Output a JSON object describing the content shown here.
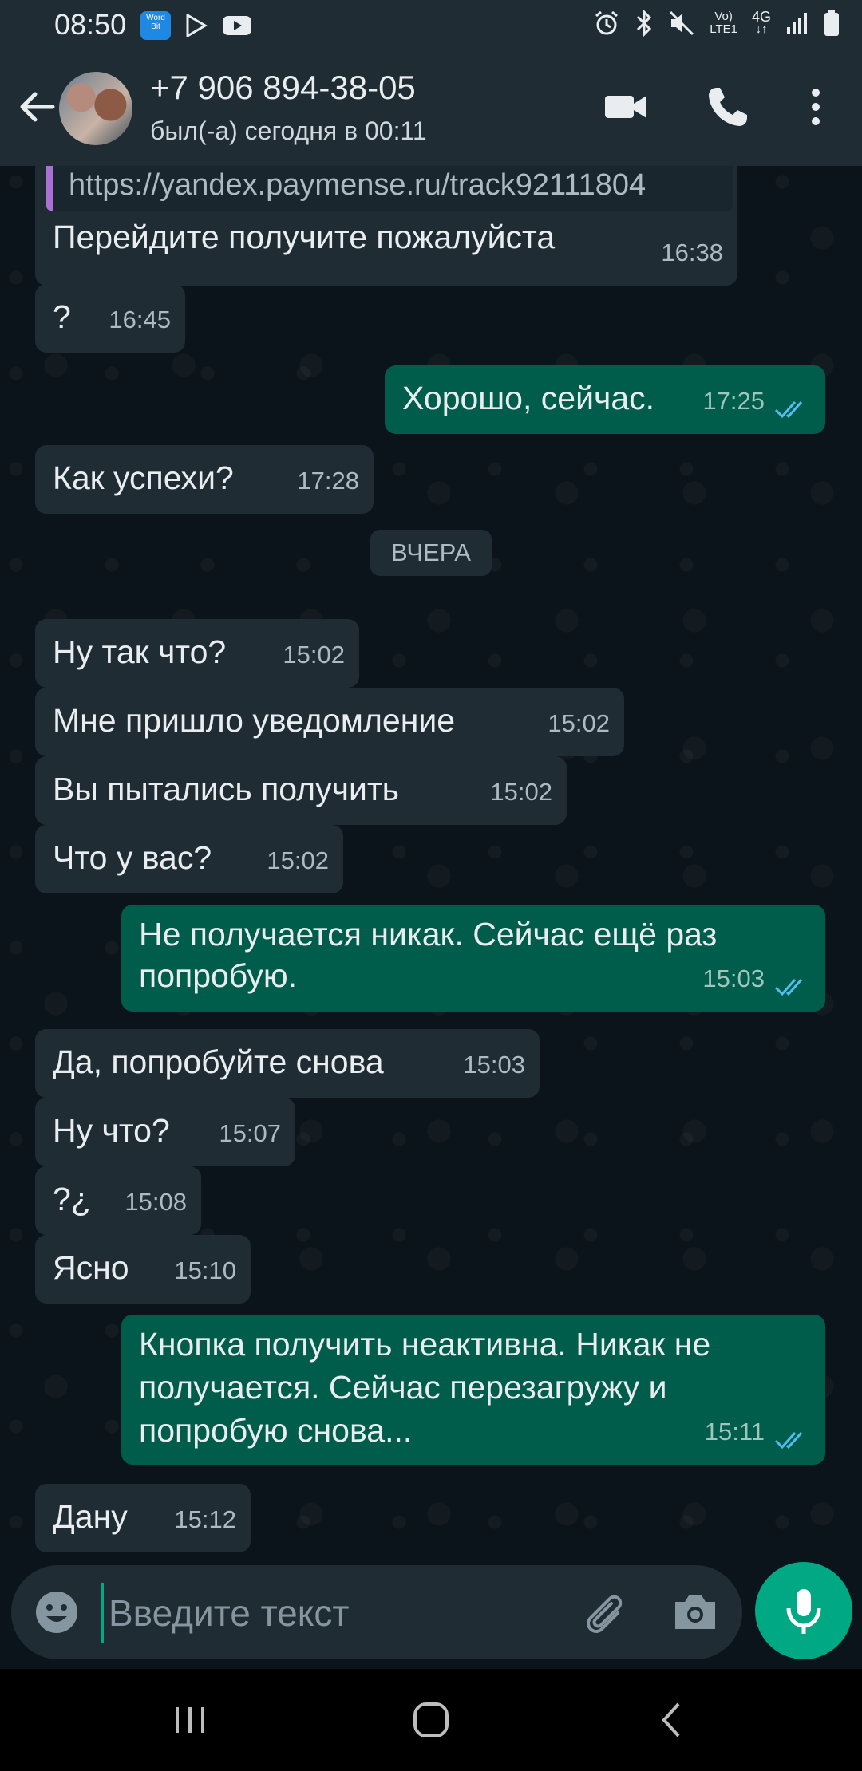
{
  "status_bar": {
    "time": "08:50",
    "app_icon_label": "Word Bit",
    "network_label_top": "Vo)",
    "network_label_bottom": "LTE1",
    "data_label": "4G",
    "icons": [
      "wordbit-app-icon",
      "play-store-icon",
      "youtube-icon",
      "alarm-icon",
      "bluetooth-icon",
      "mute-icon",
      "volte-icon",
      "4g-icon",
      "signal-icon",
      "battery-icon"
    ]
  },
  "header": {
    "contact_name": "+7 906 894-38-05",
    "contact_status": "был(-а) сегодня в 00:11",
    "icons": [
      "back-arrow-icon",
      "video-call-icon",
      "phone-icon",
      "more-vert-icon"
    ]
  },
  "messages": [
    {
      "dir": "in",
      "quote": "https://yandex.paymense.ru/track92111804",
      "text": "Перейдите получите пожалуйста",
      "time": "16:38"
    },
    {
      "dir": "in",
      "text": "?",
      "time": "16:45"
    },
    {
      "dir": "out",
      "text": "Хорошо, сейчас.",
      "time": "17:25"
    },
    {
      "dir": "in",
      "text": "Как успехи?",
      "time": "17:28"
    },
    {
      "dir": "in",
      "text": "Ну так что?",
      "time": "15:02"
    },
    {
      "dir": "in",
      "text": "Мне пришло уведомление",
      "time": "15:02"
    },
    {
      "dir": "in",
      "text": "Вы пытались получить",
      "time": "15:02"
    },
    {
      "dir": "in",
      "text": "Что у вас?",
      "time": "15:02"
    },
    {
      "dir": "out",
      "lines": [
        "Не получается никак. Сейчас ещё раз",
        "попробую."
      ],
      "time": "15:03"
    },
    {
      "dir": "in",
      "text": "Да, попробуйте снова",
      "time": "15:03"
    },
    {
      "dir": "in",
      "text": "Ну что?",
      "time": "15:07"
    },
    {
      "dir": "in",
      "text": "?¿",
      "time": "15:08"
    },
    {
      "dir": "in",
      "text": "Ясно",
      "time": "15:10"
    },
    {
      "dir": "out",
      "lines": [
        "Кнопка получить неактивна. Никак не",
        "получается. Сейчас перезагружу и",
        "попробую снова..."
      ],
      "time": "15:11"
    },
    {
      "dir": "in",
      "text": "Дану",
      "time": "15:12"
    }
  ],
  "date_divider": "ВЧЕРА",
  "composer": {
    "placeholder": "Введите текст",
    "value": "",
    "icons": [
      "emoji-icon",
      "attach-icon",
      "camera-icon",
      "mic-icon"
    ]
  },
  "nav_bar": {
    "icons": [
      "recents-icon",
      "home-icon",
      "back-icon"
    ]
  },
  "colors": {
    "incoming_bubble": "#1f2c34",
    "outgoing_bubble": "#005c4b",
    "accent": "#00a884",
    "read_ticks": "#53bdeb",
    "quote_bar": "#a971d6"
  }
}
